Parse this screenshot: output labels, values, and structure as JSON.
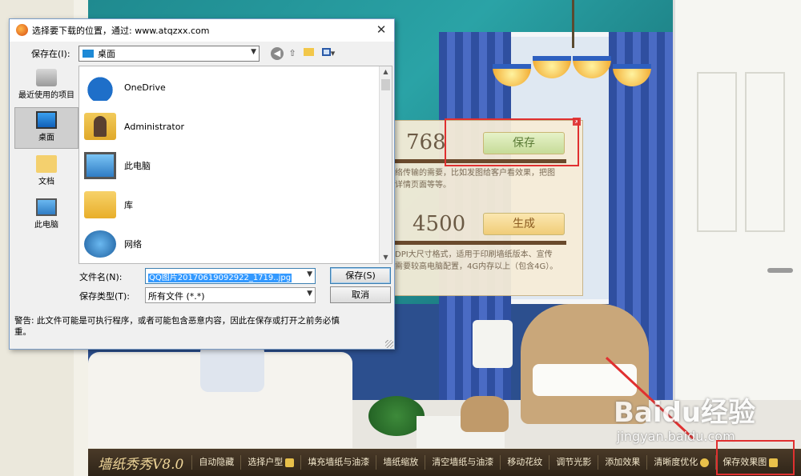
{
  "dialog": {
    "title": "选择要下载的位置，通过: www.atqzxx.com",
    "save_in_label": "保存在(I):",
    "save_in_value": "桌面",
    "places": [
      {
        "label": "最近使用的项目",
        "icon": "recent-icon"
      },
      {
        "label": "桌面",
        "icon": "desktop-icon",
        "selected": true
      },
      {
        "label": "文档",
        "icon": "documents-icon"
      },
      {
        "label": "此电脑",
        "icon": "this-pc-icon"
      }
    ],
    "files": [
      {
        "name": "OneDrive",
        "icon": "onedrive-icon"
      },
      {
        "name": "Administrator",
        "icon": "user-folder-icon"
      },
      {
        "name": "此电脑",
        "icon": "computer-icon"
      },
      {
        "name": "库",
        "icon": "library-icon"
      },
      {
        "name": "网络",
        "icon": "network-icon"
      }
    ],
    "filename_label": "文件名(N):",
    "filename_value": "QQ图片20170619092922_1719..jpg",
    "filetype_label": "保存类型(T):",
    "filetype_value": "所有文件 (*.*)",
    "save_button": "保存(S)",
    "cancel_button": "取消",
    "warning": "警告: 此文件可能是可执行程序，或者可能包含恶意内容，因此在保存或打开之前务必慎重。"
  },
  "size_panel": {
    "option1_size": "768",
    "option1_button": "保存",
    "option1_desc": "络传输的需要，比如发图给客户看效果，把图\n详情页面等等。",
    "option2_size": "4500",
    "option2_button": "生成",
    "option2_desc": "DPI大尺寸格式，适用于印刷墙纸版本、宣传\n需要较高电脑配置，4G内存以上（包含4G）。",
    "close": "x"
  },
  "toolbar": {
    "app_name": "墙纸秀秀V8.0",
    "items": [
      "自动隐藏",
      "选择户型",
      "填充墙纸与油漆",
      "墙纸缩放",
      "清空墙纸与油漆",
      "移动花纹",
      "调节光影",
      "添加效果",
      "清晰度优化",
      "保存效果图"
    ]
  },
  "watermark": {
    "logo": "Baidu经验",
    "url": "jingyan.baidu.com"
  },
  "colors": {
    "highlight": "#e03030",
    "toolbar_bg": "#2e2418",
    "dialog_bg": "#f0f0f0",
    "selection": "#3399ff"
  }
}
